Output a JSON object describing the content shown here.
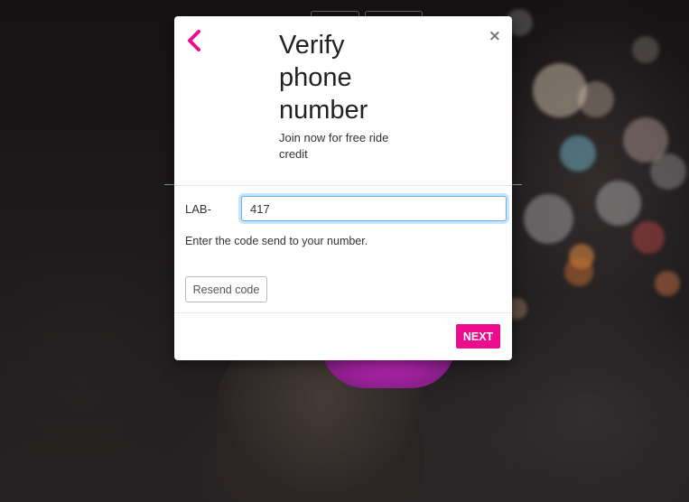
{
  "modal": {
    "title": "Verify phone number",
    "subtitle": "Join now for free ride credit",
    "back_icon": "chevron-left-icon",
    "close_icon": "×",
    "code_prefix_label": "LAB-",
    "code_value": "417",
    "help_text": "Enter the code send to your number.",
    "resend_label": "Resend code",
    "next_label": "NEXT"
  },
  "colors": {
    "accent": "#ec0d8f",
    "input_focus": "#66afe9",
    "text": "#222222"
  }
}
